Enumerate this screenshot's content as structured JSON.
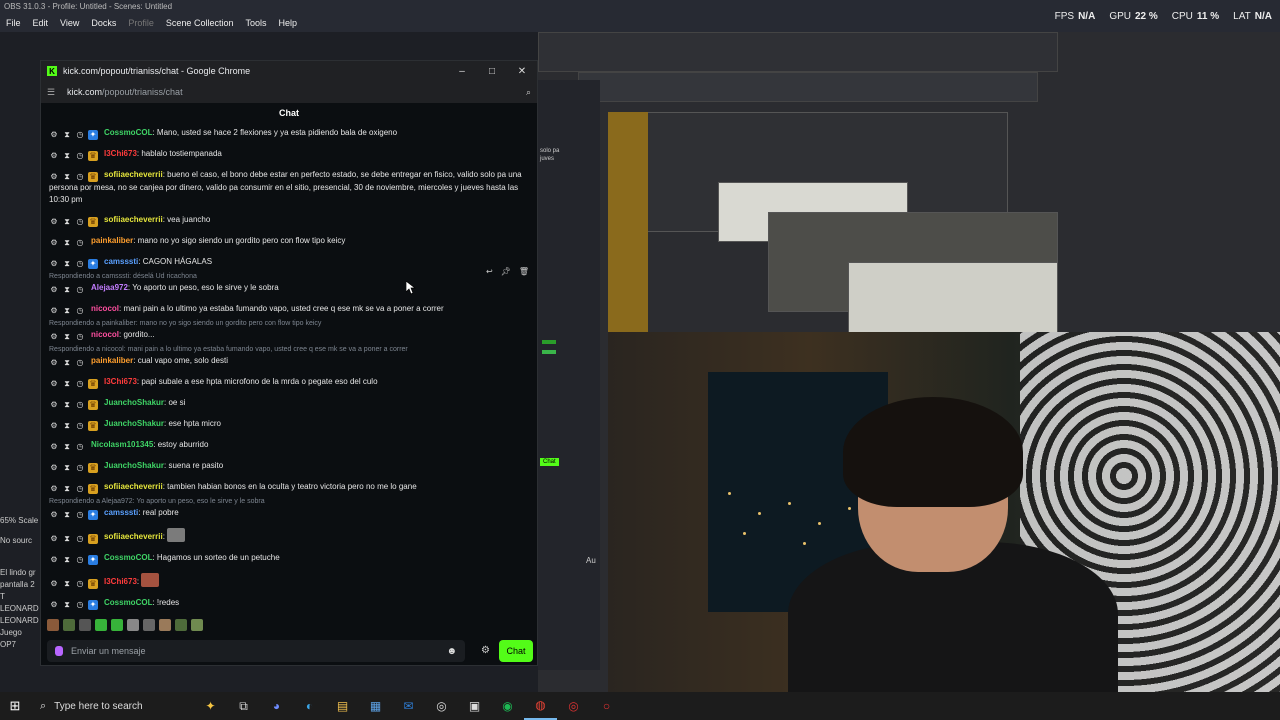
{
  "obs": {
    "title": "OBS 31.0.3 - Profile: Untitled - Scenes: Untitled",
    "menu": [
      "File",
      "Edit",
      "View",
      "Docks",
      "Profile",
      "Scene Collection",
      "Tools",
      "Help"
    ],
    "stats": [
      {
        "label": "FPS",
        "value": "N/A"
      },
      {
        "label": "GPU",
        "value": "22 %"
      },
      {
        "label": "CPU",
        "value": "11 %"
      },
      {
        "label": "LAT",
        "value": "N/A"
      }
    ],
    "left_items": [
      "65% Scale",
      "No sourc",
      "El lindo gr",
      "pantalla 2",
      "T",
      "LEONARD",
      "LEONARD",
      "Juego",
      "OP7"
    ],
    "strip_labels": [
      "solo pa",
      "juves",
      "Chat",
      "Au"
    ]
  },
  "chrome": {
    "window_title": "kick.com/popout/trianiss/chat - Google Chrome",
    "url_domain": "kick.com",
    "url_path": "/popout/trianiss/chat",
    "favicon": "K",
    "controls": [
      "–",
      "□",
      "✕"
    ]
  },
  "chat": {
    "header": "Chat",
    "messages": [
      {
        "user": "CossmoCOL",
        "color": "#3fd466",
        "badges": [
          "gear",
          "hourglass",
          "clock",
          "vip"
        ],
        "text": "Mano, usted se hace 2 flexiones y ya esta pidiendo bala de oxigeno"
      },
      {
        "user": "I3Chi673",
        "color": "#ff3c3c",
        "badges": [
          "gear",
          "hourglass",
          "clock",
          "sub"
        ],
        "text": "hablalo tostiempanada"
      },
      {
        "user": "sofiiaecheverrii",
        "color": "#e6e63c",
        "badges": [
          "gear",
          "hourglass",
          "clock",
          "sub"
        ],
        "text": "bueno el caso, el bono debe estar en perfecto estado, se debe entregar en fisico, valido solo pa una persona por mesa, no se canjea por dinero, valido pa consumir en el sitio, presencial, 30 de noviembre, miercoles y jueves hasta las 10:30 pm"
      },
      {
        "user": "sofiiaecheverrii",
        "color": "#e6e63c",
        "badges": [
          "gear",
          "hourglass",
          "clock",
          "sub"
        ],
        "text": "vea juancho"
      },
      {
        "user": "painkaliber",
        "color": "#ff9f2e",
        "badges": [
          "gear",
          "hourglass",
          "clock"
        ],
        "text": "mano no yo sigo siendo un gordito pero con flow tipo keicy"
      },
      {
        "user": "camsssti",
        "color": "#5aa0ff",
        "badges": [
          "gear",
          "hourglass",
          "clock",
          "vip"
        ],
        "text": "CAGON HÁGALAS"
      },
      {
        "reply": "Respondiendo a camsssti: déselá Ud ricachona"
      },
      {
        "user": "Alejaa972",
        "color": "#c37dff",
        "badges": [
          "gear",
          "hourglass",
          "clock"
        ],
        "text": "Yo aporto un peso, eso le sirve y le sobra"
      },
      {
        "user": "nicocol",
        "color": "#ff4fa0",
        "badges": [
          "gear",
          "hourglass",
          "clock"
        ],
        "text": "mani pain a lo ultimo ya estaba fumando vapo, usted cree q ese mk se va a poner a correr"
      },
      {
        "reply": "Respondiendo a painkaliber: mano no yo sigo siendo un gordito pero con flow tipo keicy"
      },
      {
        "user": "nicocol",
        "color": "#ff4fa0",
        "badges": [
          "gear",
          "hourglass",
          "clock"
        ],
        "text": "gordito..."
      },
      {
        "reply": "Respondiendo a nicocol: mani pain a lo ultimo ya estaba fumando vapo, usted cree q ese mk se va a poner a correr"
      },
      {
        "user": "painkaliber",
        "color": "#ff9f2e",
        "badges": [
          "gear",
          "hourglass",
          "clock"
        ],
        "text": "cual vapo ome, solo desti"
      },
      {
        "user": "I3Chi673",
        "color": "#ff3c3c",
        "badges": [
          "gear",
          "hourglass",
          "clock",
          "sub"
        ],
        "text": "papi subale a ese hpta microfono de la mrda o pegate eso del culo"
      },
      {
        "user": "JuanchoShakur",
        "color": "#3fd466",
        "badges": [
          "gear",
          "hourglass",
          "clock",
          "sub"
        ],
        "text": "oe si"
      },
      {
        "user": "JuanchoShakur",
        "color": "#3fd466",
        "badges": [
          "gear",
          "hourglass",
          "clock",
          "sub"
        ],
        "text": "ese hpta micro"
      },
      {
        "user": "Nicolasm101345",
        "color": "#3fd466",
        "badges": [
          "gear",
          "hourglass",
          "clock"
        ],
        "text": "estoy aburrido"
      },
      {
        "user": "JuanchoShakur",
        "color": "#3fd466",
        "badges": [
          "gear",
          "hourglass",
          "clock",
          "sub"
        ],
        "text": "suena re pasito"
      },
      {
        "user": "sofiiaecheverrii",
        "color": "#e6e63c",
        "badges": [
          "gear",
          "hourglass",
          "clock",
          "sub"
        ],
        "text": "tambien habian bonos en la oculta y teatro victoria pero no me lo gane"
      },
      {
        "reply": "Respondiendo a Alejaa972: Yo aporto un peso, eso le sirve y le sobra"
      },
      {
        "user": "camsssti",
        "color": "#5aa0ff",
        "badges": [
          "gear",
          "hourglass",
          "clock",
          "vip"
        ],
        "text": "real pobre"
      },
      {
        "user": "sofiiaecheverrii",
        "color": "#e6e63c",
        "badges": [
          "gear",
          "hourglass",
          "clock",
          "sub"
        ],
        "text": "",
        "emote": "gray"
      },
      {
        "user": "CossmoCOL",
        "color": "#3fd466",
        "badges": [
          "gear",
          "hourglass",
          "clock",
          "vip"
        ],
        "text": "Hagamos un sorteo de un petuche"
      },
      {
        "user": "I3Chi673",
        "color": "#ff3c3c",
        "badges": [
          "gear",
          "hourglass",
          "clock",
          "sub"
        ],
        "text": "",
        "emote": "red"
      },
      {
        "user": "CossmoCOL",
        "color": "#3fd466",
        "badges": [
          "gear",
          "hourglass",
          "clock",
          "vip"
        ],
        "text": "!redes"
      }
    ],
    "input_placeholder": "Enviar un mensaje",
    "send_label": "Chat"
  },
  "taskbar": {
    "search_placeholder": "Type here to search",
    "icons": [
      "sparkle-icon",
      "task-view-icon",
      "copilot-icon",
      "edge-icon",
      "file-explorer-icon",
      "calculator-icon",
      "outlook-icon",
      "steam-icon",
      "app-icon",
      "spotify-icon",
      "chrome-icon",
      "obs-icon",
      "opera-icon"
    ]
  }
}
